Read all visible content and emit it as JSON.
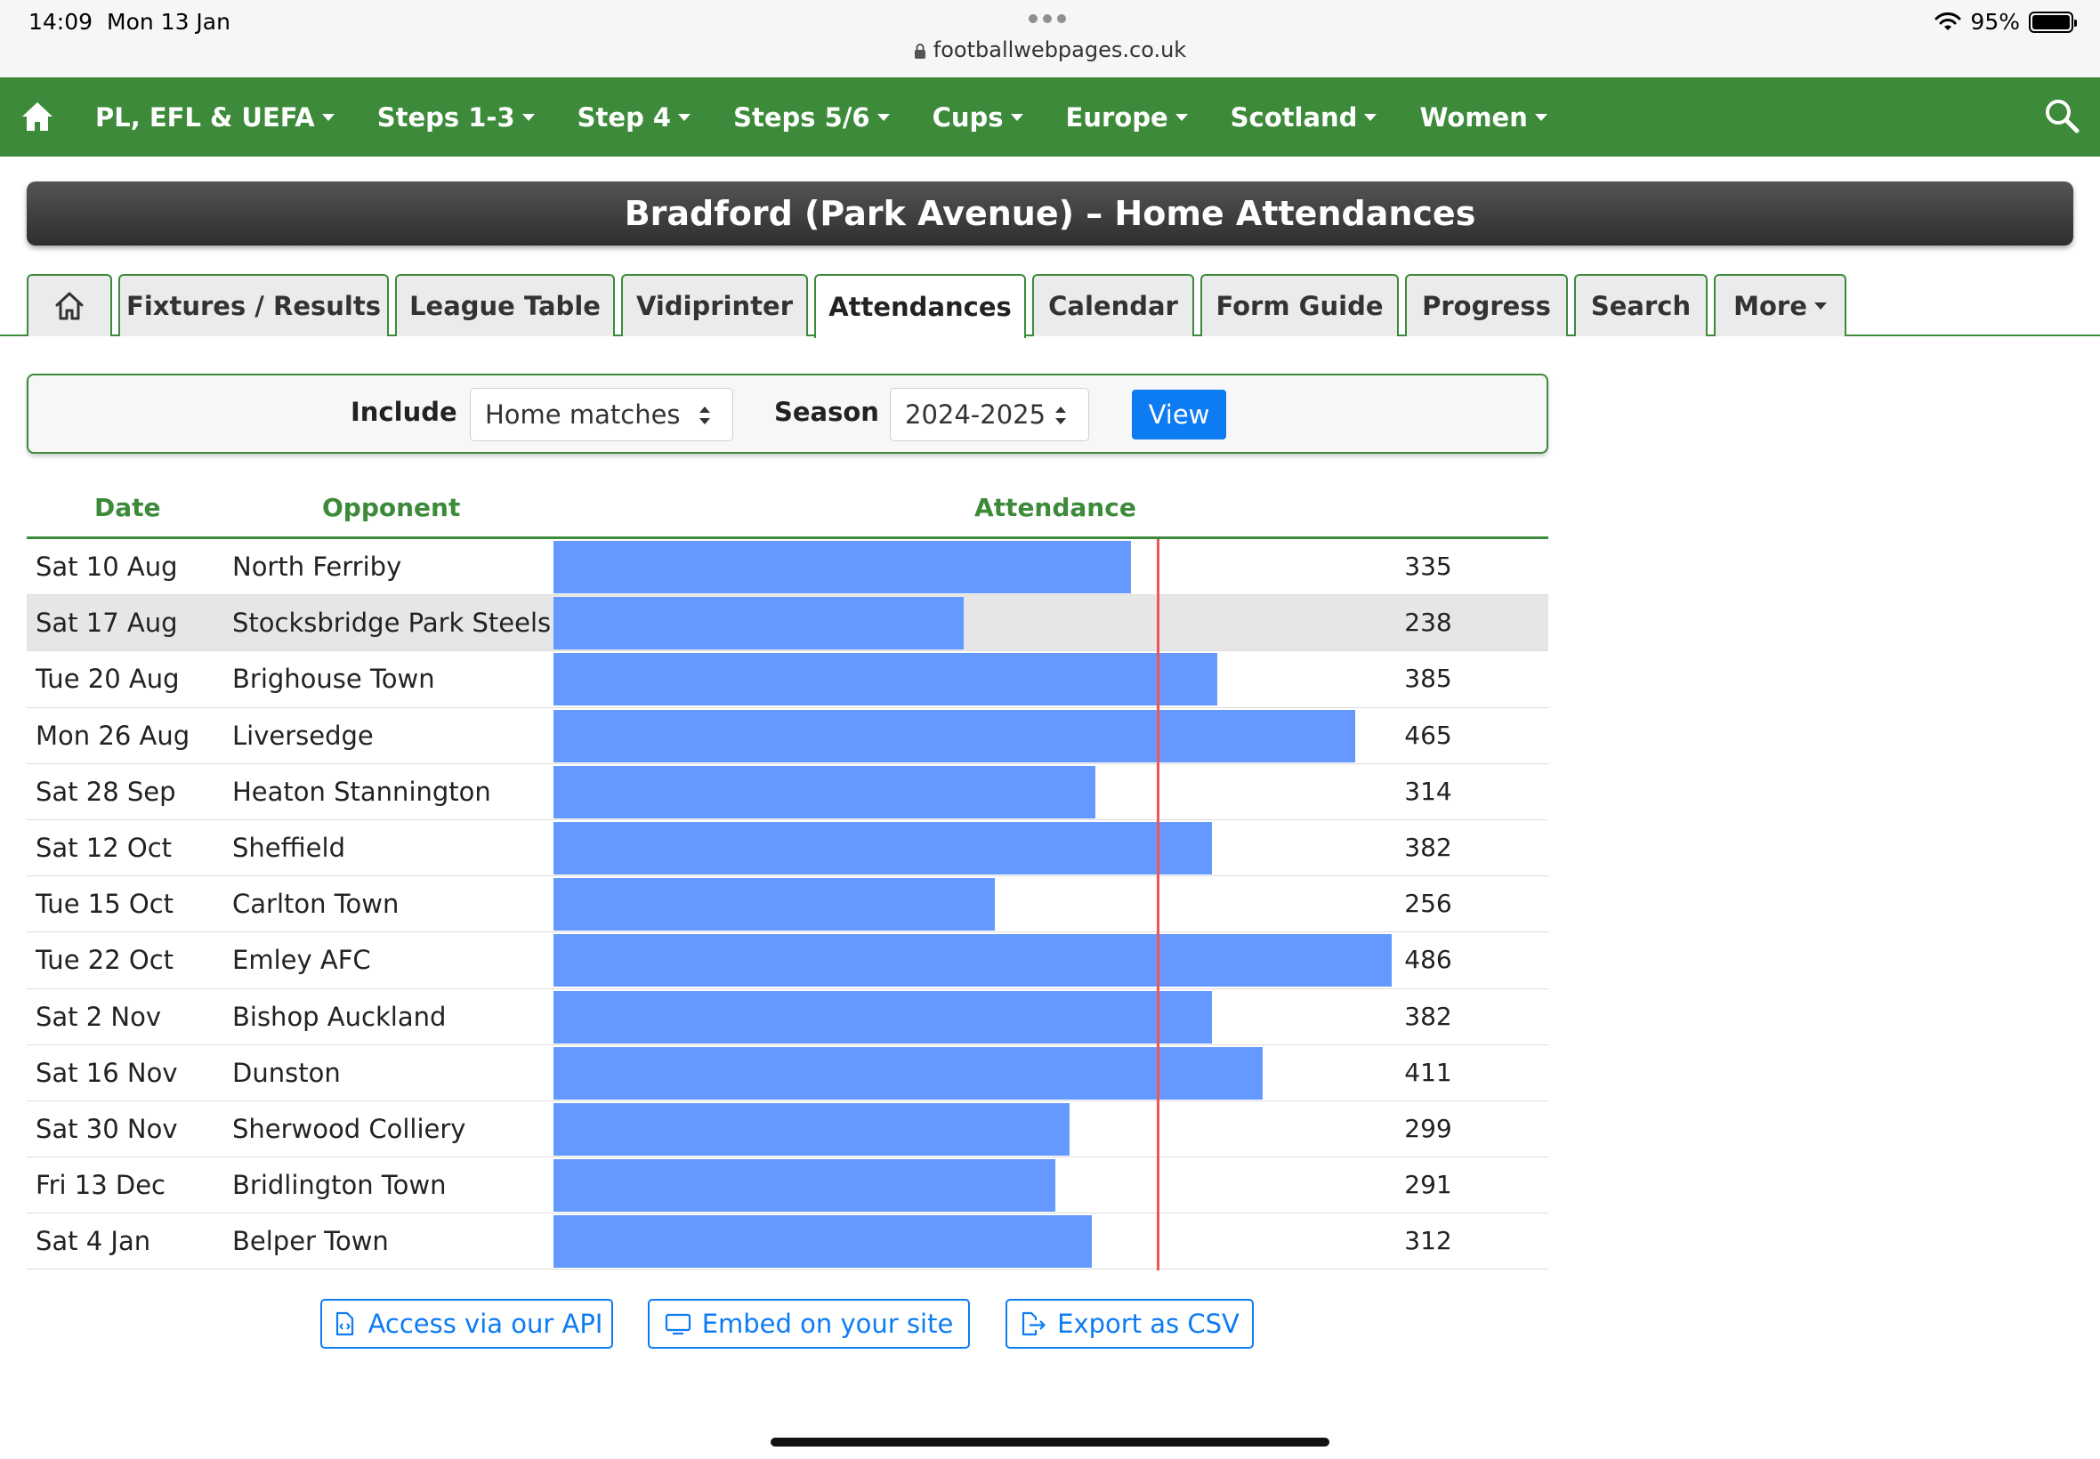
{
  "status_bar": {
    "time": "14:09",
    "date": "Mon 13 Jan",
    "url": "footballwebpages.co.uk",
    "battery": "95%"
  },
  "navbar": {
    "items": [
      {
        "label": "PL, EFL & UEFA"
      },
      {
        "label": "Steps 1-3"
      },
      {
        "label": "Step 4"
      },
      {
        "label": "Steps 5/6"
      },
      {
        "label": "Cups"
      },
      {
        "label": "Europe"
      },
      {
        "label": "Scotland"
      },
      {
        "label": "Women"
      }
    ],
    "color": "#3c8a3a"
  },
  "page_title": "Bradford (Park Avenue) – Home Attendances",
  "tabs": [
    {
      "label": "Fixtures / Results"
    },
    {
      "label": "League Table"
    },
    {
      "label": "Vidiprinter"
    },
    {
      "label": "Attendances"
    },
    {
      "label": "Calendar"
    },
    {
      "label": "Form Guide"
    },
    {
      "label": "Progress"
    },
    {
      "label": "Search"
    },
    {
      "label": "More"
    }
  ],
  "active_tab": "Attendances",
  "filters": {
    "include_label": "Include",
    "include_value": "Home matches",
    "season_label": "Season",
    "season_value": "2024-2025",
    "view_label": "View"
  },
  "table": {
    "headers": {
      "date": "Date",
      "opponent": "Opponent",
      "attendance": "Attendance"
    },
    "max_value": 486,
    "average_line": 349.8,
    "bar_color": "#6699ff",
    "average_color": "#ee5555",
    "rows": [
      {
        "date": "Sat 10 Aug",
        "opponent": "North Ferriby",
        "attendance": "335"
      },
      {
        "date": "Sat 17 Aug",
        "opponent": "Stocksbridge Park Steels",
        "attendance": "238"
      },
      {
        "date": "Tue 20 Aug",
        "opponent": "Brighouse Town",
        "attendance": "385"
      },
      {
        "date": "Mon 26 Aug",
        "opponent": "Liversedge",
        "attendance": "465"
      },
      {
        "date": "Sat 28 Sep",
        "opponent": "Heaton Stannington",
        "attendance": "314"
      },
      {
        "date": "Sat 12 Oct",
        "opponent": "Sheffield",
        "attendance": "382"
      },
      {
        "date": "Tue 15 Oct",
        "opponent": "Carlton Town",
        "attendance": "256"
      },
      {
        "date": "Tue 22 Oct",
        "opponent": "Emley AFC",
        "attendance": "486"
      },
      {
        "date": "Sat 2 Nov",
        "opponent": "Bishop Auckland",
        "attendance": "382"
      },
      {
        "date": "Sat 16 Nov",
        "opponent": "Dunston",
        "attendance": "411"
      },
      {
        "date": "Sat 30 Nov",
        "opponent": "Sherwood Colliery",
        "attendance": "299"
      },
      {
        "date": "Fri 13 Dec",
        "opponent": "Bridlington Town",
        "attendance": "291"
      },
      {
        "date": "Sat 4 Jan",
        "opponent": "Belper Town",
        "attendance": "312"
      }
    ]
  },
  "actions": {
    "api_label": "Access via our API",
    "embed_label": "Embed on your site",
    "csv_label": "Export as CSV"
  }
}
